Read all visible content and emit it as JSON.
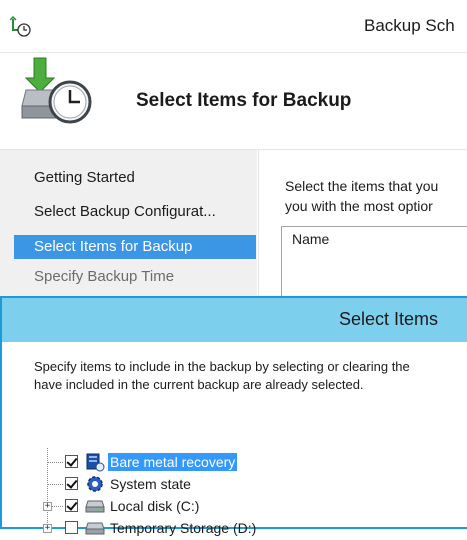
{
  "wizard": {
    "title": "Backup Sch",
    "heading": "Select Items for Backup",
    "nav": [
      {
        "label": "Getting Started",
        "state": "normal"
      },
      {
        "label": "Select Backup Configurat...",
        "state": "normal"
      },
      {
        "label": "Select Items for Backup",
        "state": "selected"
      },
      {
        "label": "Specify Backup Time",
        "state": "disabled"
      }
    ],
    "content": {
      "desc_line1": "Select the items that you",
      "desc_line2": "you with the most optior",
      "column_header": "Name"
    }
  },
  "dialog": {
    "title": "Select Items",
    "desc_line1": "Specify items to include in the backup by selecting or clearing the",
    "desc_line2": "have included in the current backup are already selected.",
    "tree": [
      {
        "label": "Bare metal recovery",
        "checked": true,
        "selected": true,
        "icon": "server-icon"
      },
      {
        "label": "System state",
        "checked": true,
        "selected": false,
        "icon": "gear-icon"
      },
      {
        "label": "Local disk (C:)",
        "checked": true,
        "selected": false,
        "icon": "drive-icon",
        "expander": "+"
      },
      {
        "label": "Temporary Storage (D:)",
        "checked": false,
        "selected": false,
        "icon": "drive-icon",
        "expander": "+"
      }
    ]
  },
  "colors": {
    "accent": "#1e9ad6",
    "dialog_titlebar": "#7dcfee",
    "nav_selected": "#3c96e6",
    "tree_selected": "#3399ff"
  }
}
